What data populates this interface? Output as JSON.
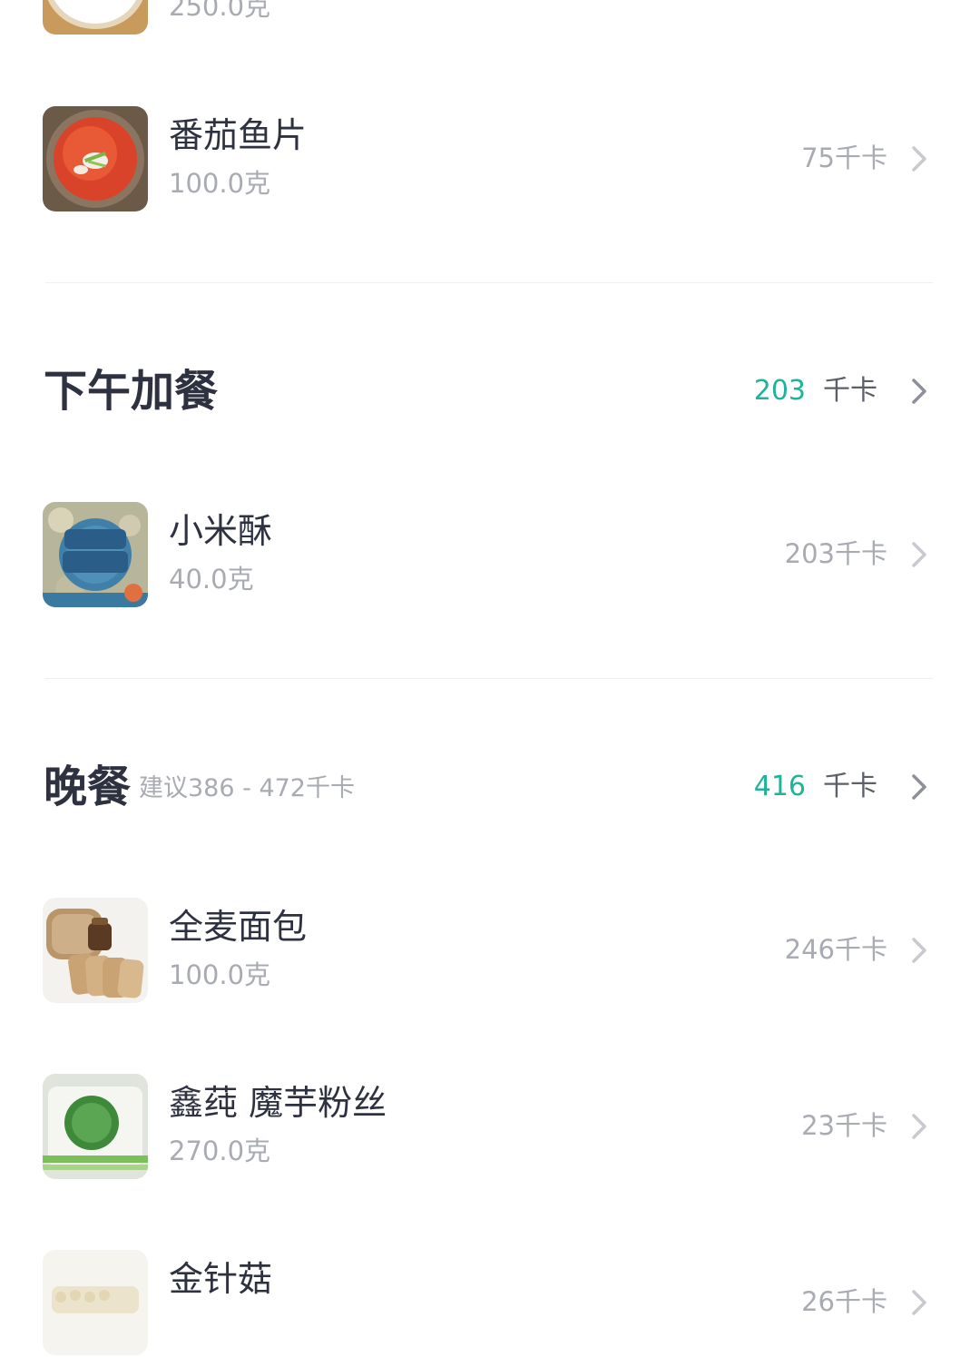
{
  "top_partial_item": {
    "weight": "250.0克"
  },
  "afternoon_snack": {
    "title": "下午加餐",
    "total": "203",
    "unit": "千卡"
  },
  "dinner": {
    "title": "晚餐",
    "suggestion": "建议386 - 472千卡",
    "total": "416",
    "unit": "千卡"
  },
  "items": [
    {
      "name": "番茄鱼片",
      "weight": "100.0克",
      "kcal": "75千卡",
      "thumb_icon": "tomato-fish-photo"
    },
    {
      "name": "小米酥",
      "weight": "40.0克",
      "kcal": "203千卡",
      "thumb_icon": "millet-crisp-package-photo"
    },
    {
      "name": "全麦面包",
      "weight": "100.0克",
      "kcal": "246千卡",
      "thumb_icon": "whole-wheat-bread-photo"
    },
    {
      "name": "鑫莼 魔芋粉丝",
      "weight": "270.0克",
      "kcal": "23千卡",
      "thumb_icon": "konjac-noodles-photo"
    },
    {
      "name": "金针菇",
      "kcal": "26千卡",
      "thumb_icon": "enoki-mushroom-photo"
    }
  ],
  "colors": {
    "accent_green": "#1fb39a",
    "text_primary": "#2e3140",
    "text_secondary": "#a9abb2",
    "chevron": "#c8cad0"
  }
}
